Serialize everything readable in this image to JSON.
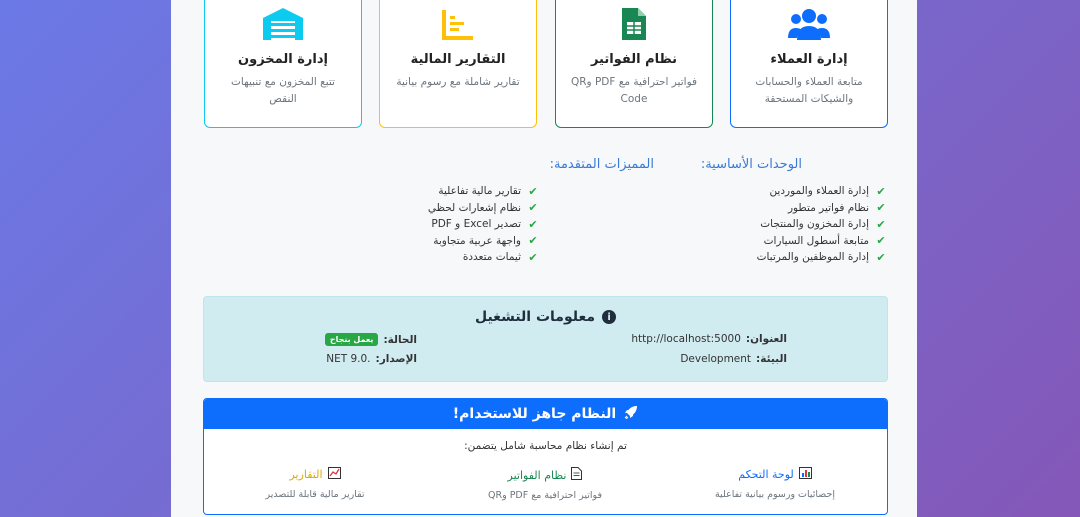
{
  "cards": [
    {
      "title": "إدارة العملاء",
      "desc": "متابعة العملاء والحسابات والشيكات المستحقة",
      "icon": "users-icon",
      "color": "#0d6efd"
    },
    {
      "title": "نظام الفواتير",
      "desc": "فواتير احترافية مع PDF وQR Code",
      "icon": "invoice-icon",
      "color": "#198754"
    },
    {
      "title": "التقارير المالية",
      "desc": "تقارير شاملة مع رسوم بيانية",
      "icon": "chart-icon",
      "color": "#ffc107"
    },
    {
      "title": "إدارة المخزون",
      "desc": "تتبع المخزون مع تنبيهات النقص",
      "icon": "warehouse-icon",
      "color": "#0dcaf0"
    }
  ],
  "modules": {
    "title": "الوحدات الأساسية:",
    "items": [
      "إدارة العملاء والموردين",
      "نظام فواتير متطور",
      "إدارة المخزون والمنتجات",
      "متابعة أسطول السيارات",
      "إدارة الموظفين والمرتبات"
    ]
  },
  "advanced": {
    "title": "المميزات المتقدمة:",
    "items": [
      "تقارير مالية تفاعلية",
      "نظام إشعارات لحظي",
      "تصدير Excel و PDF",
      "واجهة عربية متجاوبة",
      "ثيمات متعددة"
    ]
  },
  "runinfo": {
    "title": "معلومات التشغيل",
    "address_label": "العنوان:",
    "address": "http://localhost:5000",
    "status_label": "الحالة:",
    "status": "يعمل بنجاح",
    "env_label": "البيئة:",
    "env": "Development",
    "version_label": "الإصدار:",
    "version": ".NET 9.0"
  },
  "ready": {
    "title": "النظام جاهز للاستخدام!",
    "intro": "تم إنشاء نظام محاسبة شامل يتضمن:",
    "features": [
      {
        "title": "لوحة التحكم",
        "desc": "إحصائيات ورسوم بيانية تفاعلية",
        "icon": "dashboard-icon",
        "color": "#0d6efd"
      },
      {
        "title": "نظام الفواتير",
        "desc": "فواتير احترافية مع PDF وQR",
        "icon": "document-icon",
        "color": "#198754"
      },
      {
        "title": "التقارير",
        "desc": "تقارير مالية قابلة للتصدير",
        "icon": "report-icon",
        "color": "#e0a800"
      }
    ]
  }
}
